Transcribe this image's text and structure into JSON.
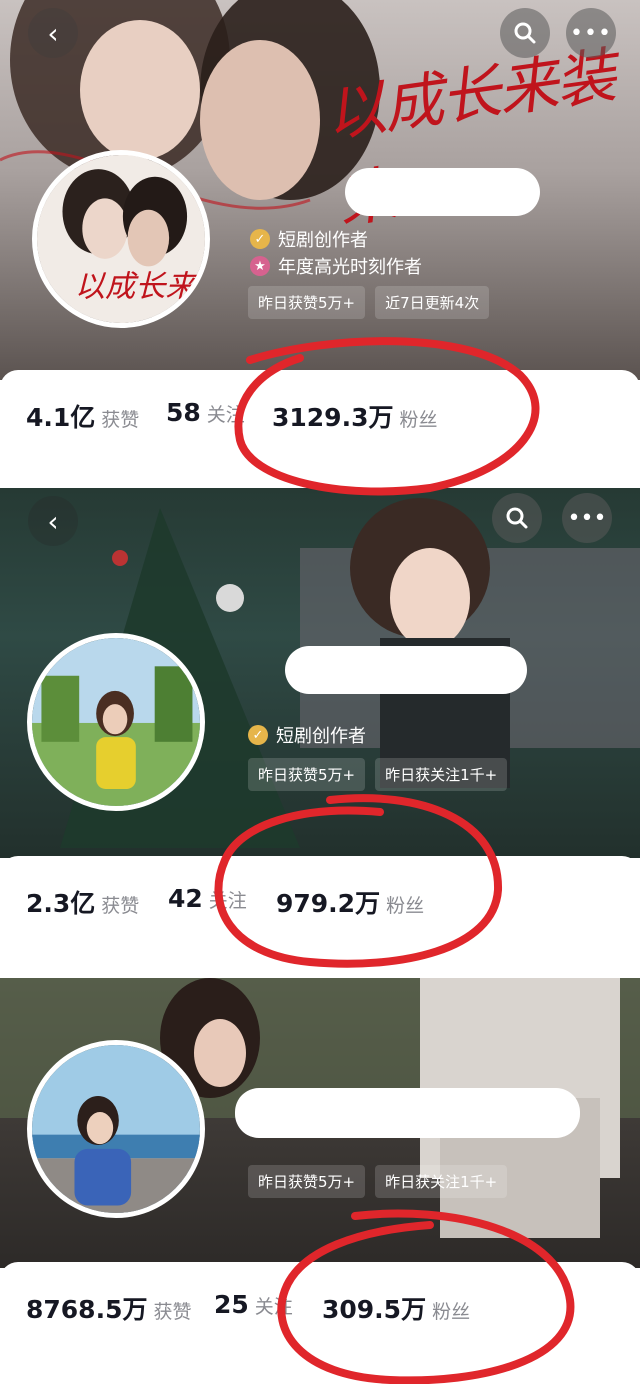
{
  "profiles": [
    {
      "hero_title": "以成长来装束",
      "badges": [
        "短剧创作者",
        "年度高光时刻作者"
      ],
      "chips": [
        "昨日获赞5万+",
        "近7日更新4次"
      ],
      "stats": [
        {
          "value": "4.1亿",
          "label": "获赞"
        },
        {
          "value": "58",
          "label": "关注"
        },
        {
          "value": "3129.3万",
          "label": "粉丝"
        }
      ]
    },
    {
      "badges": [
        "短剧创作者"
      ],
      "chips": [
        "昨日获赞5万+",
        "昨日获关注1千+"
      ],
      "stats": [
        {
          "value": "2.3亿",
          "label": "获赞"
        },
        {
          "value": "42",
          "label": "关注"
        },
        {
          "value": "979.2万",
          "label": "粉丝"
        }
      ]
    },
    {
      "chips": [
        "昨日获赞5万+",
        "昨日获关注1千+"
      ],
      "stats": [
        {
          "value": "8768.5万",
          "label": "获赞"
        },
        {
          "value": "25",
          "label": "关注"
        },
        {
          "value": "309.5万",
          "label": "粉丝"
        }
      ]
    }
  ],
  "icons": {
    "back": "chevron-left-icon",
    "search": "search-icon",
    "more": "more-dots-icon"
  },
  "colors": {
    "annotation_red": "#e0262b",
    "badge_gold": "#e6b54a",
    "badge_pink": "#d6628f"
  }
}
